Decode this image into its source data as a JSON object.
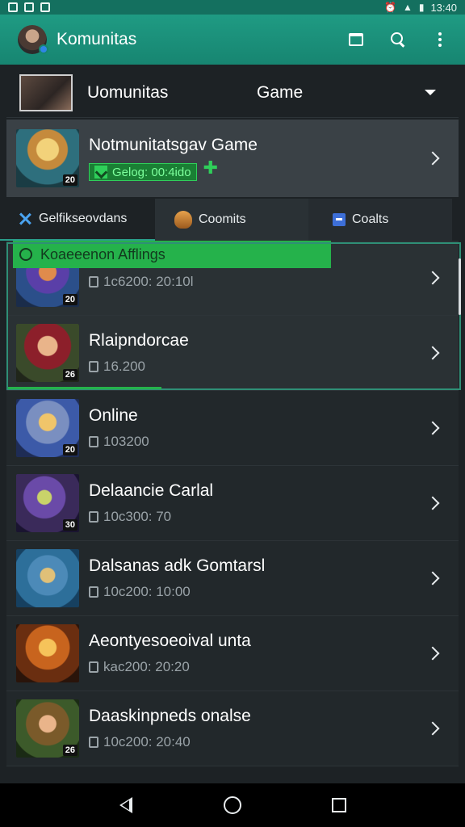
{
  "status_bar": {
    "time": "13:40"
  },
  "app_bar": {
    "title": "Komunitas"
  },
  "community": {
    "title": "Uomunitas",
    "subtitle": "Game"
  },
  "featured": {
    "title": "Notmunitatsgav Game",
    "tag": "Gelog: 00:4ido",
    "badge": "20"
  },
  "tabs": [
    {
      "label": "Gelfikseovdans"
    },
    {
      "label": "Coomits"
    },
    {
      "label": "Coalts"
    }
  ],
  "list": {
    "banner": "Koaeeenon Afflings",
    "items": [
      {
        "title": "",
        "meta": "1c6200: 20:10l",
        "badge": "20"
      },
      {
        "title": "Rlaipndorcae",
        "meta": "16.200",
        "badge": "26"
      },
      {
        "title": "Online",
        "meta": "103200",
        "badge": "20"
      },
      {
        "title": "Delaancie Carlal",
        "meta": "10c300: 70",
        "badge": "30"
      },
      {
        "title": "Dalsanas adk Gomtarsl",
        "meta": "10c200: 10:00",
        "badge": ""
      },
      {
        "title": "Aeontyesoeoival unta",
        "meta": "kac200: 20:20",
        "badge": ""
      },
      {
        "title": "Daaskinpneds onalse",
        "meta": "10c200: 20:40",
        "badge": "26"
      }
    ]
  },
  "colors": {
    "accent": "#1f9b83",
    "highlight": "#25b24b",
    "background": "#1d2225"
  }
}
